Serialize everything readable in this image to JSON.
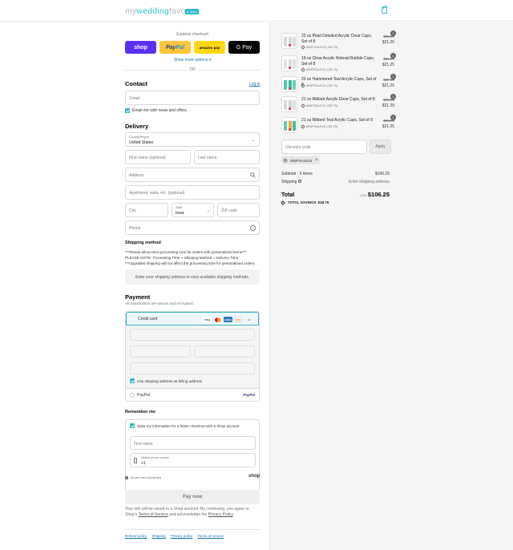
{
  "header": {
    "logo_text_prefix": "my",
    "logo_text_main": "wedding",
    "logo_text_suffix": "favors",
    "logo_badge": "& more"
  },
  "express": {
    "title": "Express checkout",
    "shop_label": "shop",
    "paypal_label_a": "Pay",
    "paypal_label_b": "Pal",
    "amazon_label": "amazon pay",
    "gpay_label": "G Pay",
    "show_more": "Show more options ▾",
    "or": "OR"
  },
  "contact": {
    "title": "Contact",
    "login_link": "Log in",
    "email_placeholder": "Email",
    "newsletter_label": "Email me with news and offers"
  },
  "delivery": {
    "title": "Delivery",
    "country_label": "Country/Region",
    "country_value": "United States",
    "first_name_placeholder": "First name (optional)",
    "last_name_placeholder": "Last name",
    "address_placeholder": "Address",
    "apartment_placeholder": "Apartment, suite, etc. (optional)",
    "city_placeholder": "City",
    "state_label": "State",
    "state_value": "Iowa",
    "zip_placeholder": "ZIP code",
    "phone_placeholder": "Phone"
  },
  "shipping": {
    "title": "Shipping method",
    "note_1": "***Please allow extra processing time for orders with personalized items***",
    "note_2": "PLEASE NOTE: Processing Time + Shipping Method = Delivery Time",
    "note_3": "***Upgraded shipping will not affect the processing time for personalized orders.",
    "placeholder_notice": "Enter your shipping address to view available shipping methods."
  },
  "payment": {
    "title": "Payment",
    "subtitle": "All transactions are secure and encrypted.",
    "credit_card_label": "Credit card",
    "card_icons": [
      "VISA",
      "MC",
      "AMEX",
      "DISC",
      "+3"
    ],
    "billing_label": "Use shipping address as billing address",
    "paypal_label": "PayPal",
    "paypal_logo": "PayPal"
  },
  "remember": {
    "title": "Remember me",
    "save_label": "Save my information for a faster checkout with a Shop account",
    "first_name_placeholder": "First name",
    "mobile_label": "Mobile phone number",
    "mobile_value": "+1",
    "secure_label": "Secure and encrypted",
    "shop_logo": "shop"
  },
  "pay_now_label": "Pay now",
  "legal": {
    "text_1": "Your info will be saved to a Shop account. By continuing, you agree to Shop's",
    "terms": "Terms of Service",
    "text_2": "and acknowledge the",
    "privacy": "Privacy Policy",
    "text_3": "."
  },
  "footer_links": [
    "Refund policy",
    "Shipping",
    "Privacy policy",
    "Terms of service"
  ],
  "cart": {
    "items": [
      {
        "qty": "1",
        "name": "22 oz Plaid Detailed Acrylic Clear Cups, Set of 8",
        "discount": "MWFSALE15 (-$3.75)",
        "original": "$25.00",
        "price": "$21.25",
        "colors": [
          "#d8d8d8",
          "#cfd4d6",
          "#d9d9d9"
        ]
      },
      {
        "qty": "1",
        "name": "19 oz Clear Acrylic Hobnail Bubble Cups, Set of 8",
        "discount": "MWFSALE15 (-$3.75)",
        "original": "$25.00",
        "price": "$21.25",
        "colors": [
          "#e3e3e3",
          "#d7dcdf",
          "#e2e2e2"
        ]
      },
      {
        "qty": "1",
        "name": "23 oz Hammered Teal Acrylic Cups, Set of 8",
        "discount": "MWFSALE15 (-$3.75)",
        "original": "$25.00",
        "price": "$21.25",
        "colors": [
          "#52c4ad",
          "#3fb59c",
          "#6ccfb9"
        ]
      },
      {
        "qty": "1",
        "name": "21 oz Ribbed Acrylic Clear Cups, Set of 8",
        "discount": "MWFSALE15 (-$3.75)",
        "original": "$25.00",
        "price": "$21.25",
        "colors": [
          "#dadada",
          "#cdd2d4",
          "#e0e0e0"
        ]
      },
      {
        "qty": "1",
        "name": "21 oz Ribbed Teal Acrylic Cups, Set of 8",
        "discount": "MWFSALE15 (-$3.75)",
        "original": "$25.00",
        "price": "$21.25",
        "colors": [
          "#5ac9b8",
          "#f0a23a",
          "#48b9a6"
        ]
      }
    ],
    "discount_placeholder": "Discount code",
    "apply_label": "Apply",
    "applied_code": "MWFSALE15",
    "subtotal_label": "Subtotal · 5 items",
    "subtotal_value": "$106.25",
    "shipping_label": "Shipping",
    "shipping_value": "Enter shipping address",
    "total_label": "Total",
    "total_currency": "USD",
    "total_value": "$106.25",
    "savings_label": "TOTAL SAVINGS",
    "savings_value": "$18.75"
  },
  "colors": {
    "accent": "#2eb6c0",
    "shop": "#5a31f4",
    "paypal": "#ffc439",
    "amazon": "#ffd814",
    "link": "#1773b0"
  }
}
